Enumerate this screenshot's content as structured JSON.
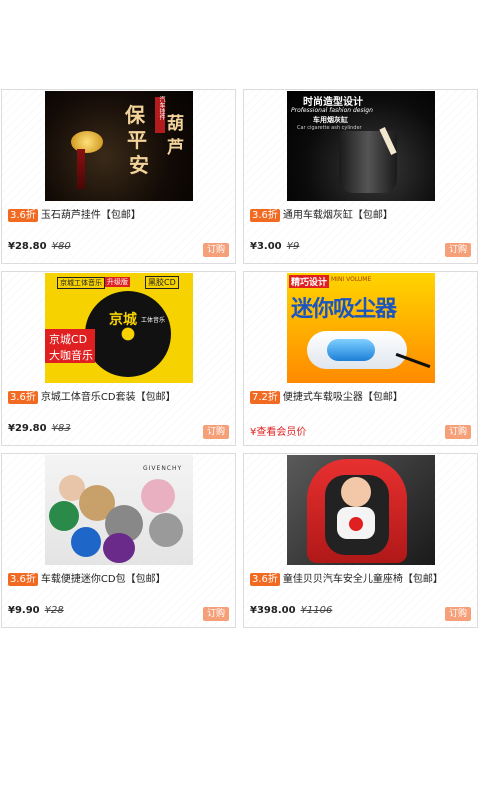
{
  "products": [
    {
      "discount": "3.6折",
      "title": "玉石葫芦挂件【包邮】",
      "price": "¥28.80",
      "old_price": "¥80",
      "order_label": "订购",
      "image_text": [
        "保",
        "平",
        "安",
        "葫",
        "芦",
        "汽车挂件"
      ]
    },
    {
      "discount": "3.6折",
      "title": "通用车载烟灰缸【包邮】",
      "price": "¥3.00",
      "old_price": "¥9",
      "order_label": "订购",
      "image_text": [
        "时尚造型设计",
        "Professional fashion design",
        "车用烟灰缸",
        "Car cigarette ash cylinder"
      ]
    },
    {
      "discount": "3.6折",
      "title": "京城工体音乐CD套装【包邮】",
      "price": "¥29.80",
      "old_price": "¥83",
      "order_label": "订购",
      "image_text": [
        "京城工体音乐",
        "升级版",
        "黑胶CD",
        "京城CD",
        "大咖音乐",
        "京城",
        "工体音乐"
      ]
    },
    {
      "discount": "7.2折",
      "title": "便捷式车载吸尘器【包邮】",
      "member_text": "¥查看会员价",
      "order_label": "订购",
      "image_text": [
        "精巧设计",
        "MINI VOLUME",
        "迷你吸尘器"
      ]
    },
    {
      "discount": "3.6折",
      "title": "车载便捷迷你CD包【包邮】",
      "price": "¥9.90",
      "old_price": "¥28",
      "order_label": "订购",
      "image_text": [
        "GIVENCHY"
      ]
    },
    {
      "discount": "3.6折",
      "title": "童佳贝贝汽车安全儿童座椅【包邮】",
      "price": "¥398.00",
      "old_price": "¥1106",
      "order_label": "订购",
      "image_text": []
    }
  ]
}
